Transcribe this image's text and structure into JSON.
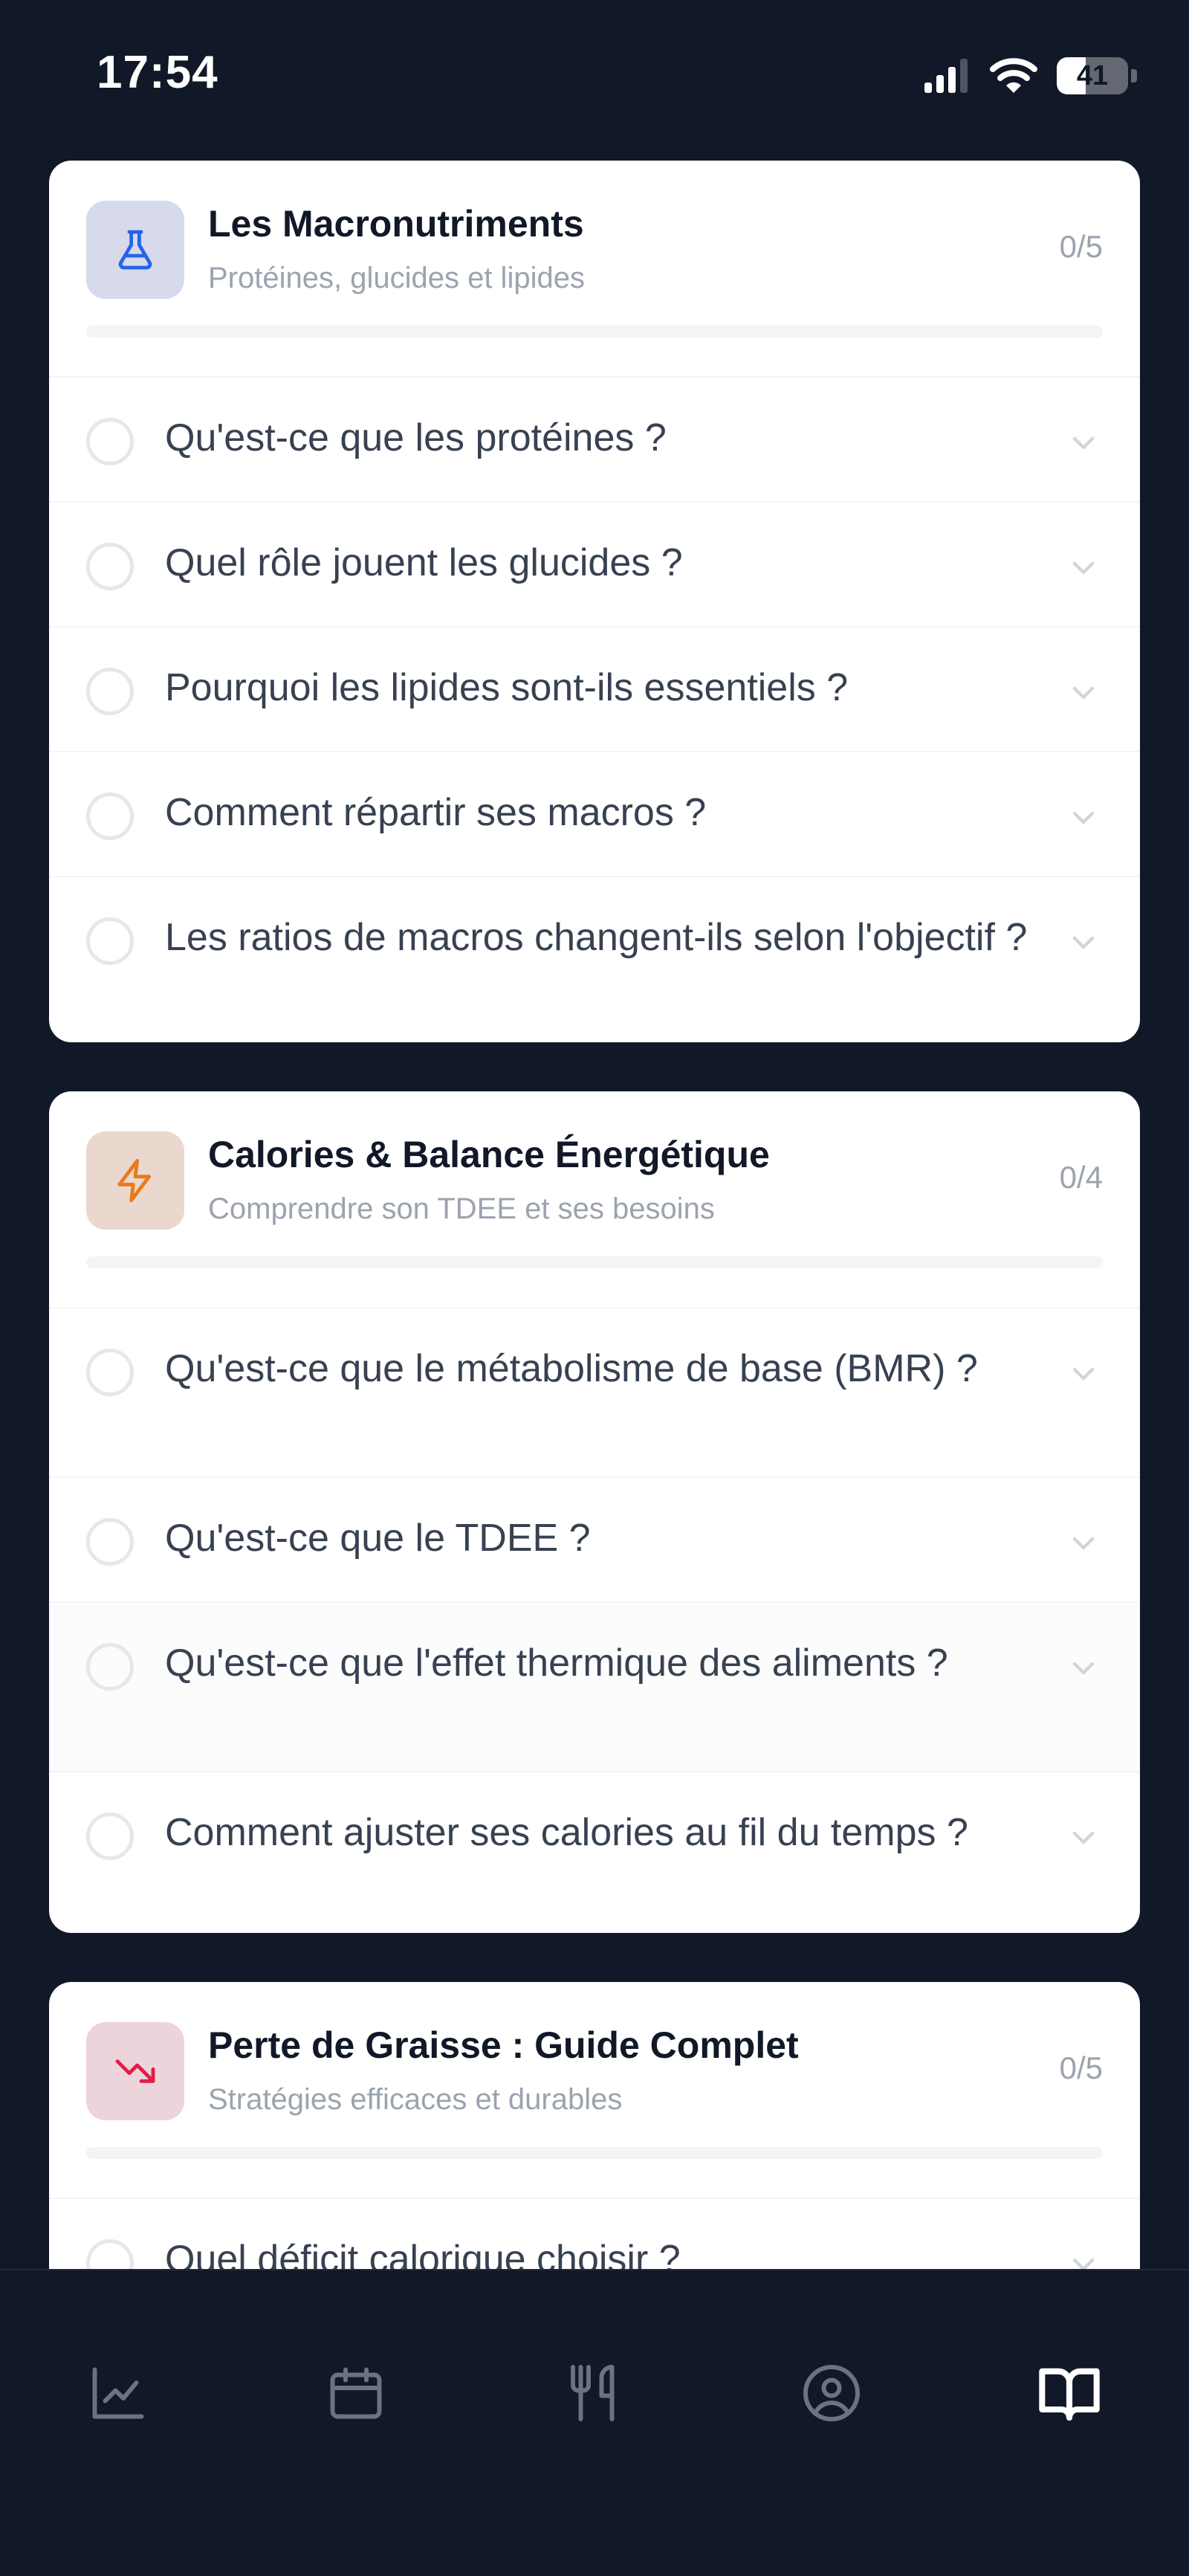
{
  "status": {
    "time": "17:54",
    "battery": "41",
    "battery_level": 0.41
  },
  "sections": [
    {
      "title": "Les Macronutriments",
      "subtitle": "Protéines, glucides et lipides",
      "count": "0/5",
      "progress": 0,
      "icon": "flask-icon",
      "icon_color": "#2563eb",
      "icon_bg": "#d6daea",
      "questions": [
        "Qu'est-ce que les protéines ?",
        "Quel rôle jouent les glucides ?",
        "Pourquoi les lipides sont-ils essentiels ?",
        "Comment répartir ses macros ?",
        "Les ratios de macros changent-ils selon l'objectif ?"
      ]
    },
    {
      "title": "Calories & Balance Énergétique",
      "subtitle": "Comprendre son TDEE et ses besoins",
      "count": "0/4",
      "progress": 0,
      "icon": "lightning-icon",
      "icon_color": "#ea7a1a",
      "icon_bg": "#ead8ce",
      "questions": [
        "Qu'est-ce que le métabolisme de base (BMR) ?",
        "Qu'est-ce que le TDEE ?",
        "Qu'est-ce que l'effet thermique des aliments ?",
        "Comment ajuster ses calories au fil du temps ?"
      ]
    },
    {
      "title": "Perte de Graisse : Guide Complet",
      "subtitle": "Stratégies efficaces et durables",
      "count": "0/5",
      "progress": 0,
      "icon": "trending-down-icon",
      "icon_color": "#e11d48",
      "icon_bg": "#edd4da",
      "questions": [
        "Quel déficit calorique choisir ?"
      ]
    }
  ],
  "nav": {
    "items": [
      "chart-icon",
      "calendar-icon",
      "utensils-icon",
      "profile-icon",
      "book-icon"
    ],
    "active": "book-icon",
    "active_color": "#ffffff",
    "inactive_color": "#6b7280"
  }
}
